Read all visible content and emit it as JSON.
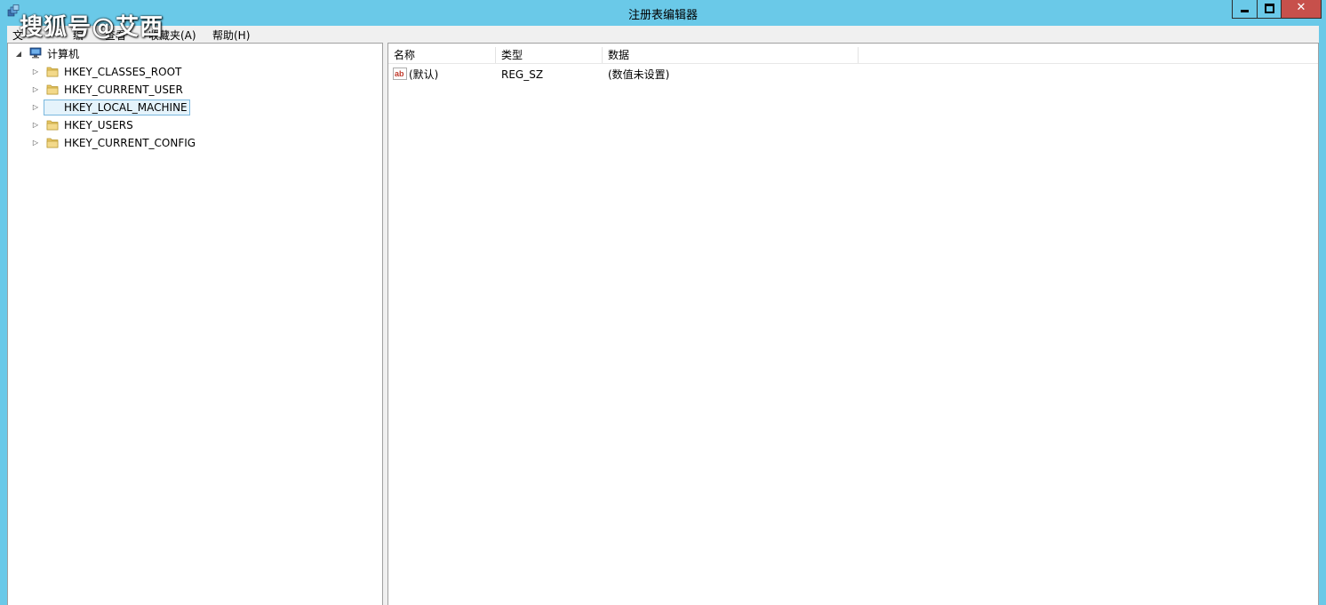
{
  "window": {
    "title": "注册表编辑器",
    "controls": {
      "minimize": "",
      "maximize": "",
      "close": "✕"
    }
  },
  "watermark": "搜狐号@艾西",
  "menu": {
    "items": [
      {
        "label": "文"
      },
      {
        "label": "编"
      },
      {
        "label": "查看"
      },
      {
        "label": "收藏夹(A)"
      },
      {
        "label": "帮助(H)"
      }
    ]
  },
  "tree": {
    "root": {
      "label": "计算机",
      "expanded": true
    },
    "nodes": [
      {
        "label": "HKEY_CLASSES_ROOT",
        "selected": false
      },
      {
        "label": "HKEY_CURRENT_USER",
        "selected": false
      },
      {
        "label": "HKEY_LOCAL_MACHINE",
        "selected": true
      },
      {
        "label": "HKEY_USERS",
        "selected": false
      },
      {
        "label": "HKEY_CURRENT_CONFIG",
        "selected": false
      }
    ]
  },
  "list": {
    "columns": [
      "名称",
      "类型",
      "数据"
    ],
    "rows": [
      {
        "name": "(默认)",
        "type": "REG_SZ",
        "data": "(数值未设置)",
        "icon": "string-value-icon"
      }
    ]
  },
  "colors": {
    "frame": "#6ac9e8",
    "close_button": "#c7504b",
    "selection": "#e5f3fb",
    "folder": "#e8c766"
  }
}
